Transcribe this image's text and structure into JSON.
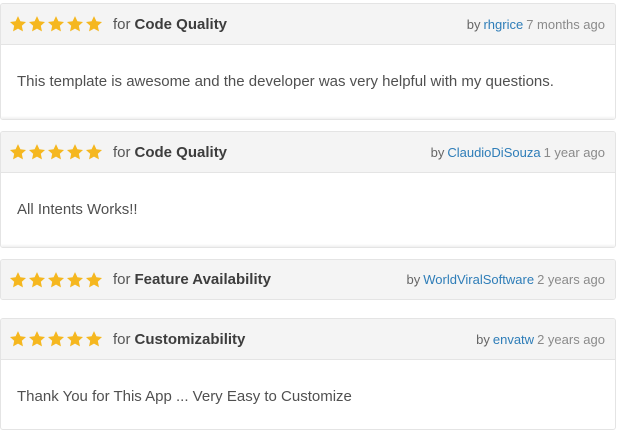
{
  "colors": {
    "star": "#f5b71f",
    "author_link": "#2e7db8",
    "header_bg": "#f4f4f4",
    "border": "#e4e4e4"
  },
  "icons": {
    "rating": "star-icon"
  },
  "reviews": [
    {
      "stars": 5,
      "for_label": "for",
      "category": "Code Quality",
      "by_label": "by",
      "author": "rhgrice",
      "time": "7 months ago",
      "body": "This template is awesome and the developer was very helpful with my questions."
    },
    {
      "stars": 5,
      "for_label": "for",
      "category": "Code Quality",
      "by_label": "by",
      "author": "ClaudioDiSouza",
      "time": "1 year ago",
      "body": "All Intents Works!!"
    },
    {
      "stars": 5,
      "for_label": "for",
      "category": "Feature Availability",
      "by_label": "by",
      "author": "WorldViralSoftware",
      "time": "2 years ago",
      "body": ""
    },
    {
      "stars": 5,
      "for_label": "for",
      "category": "Customizability",
      "by_label": "by",
      "author": "envatw",
      "time": "2 years ago",
      "body": "Thank You for This App ... Very Easy to Customize"
    }
  ]
}
